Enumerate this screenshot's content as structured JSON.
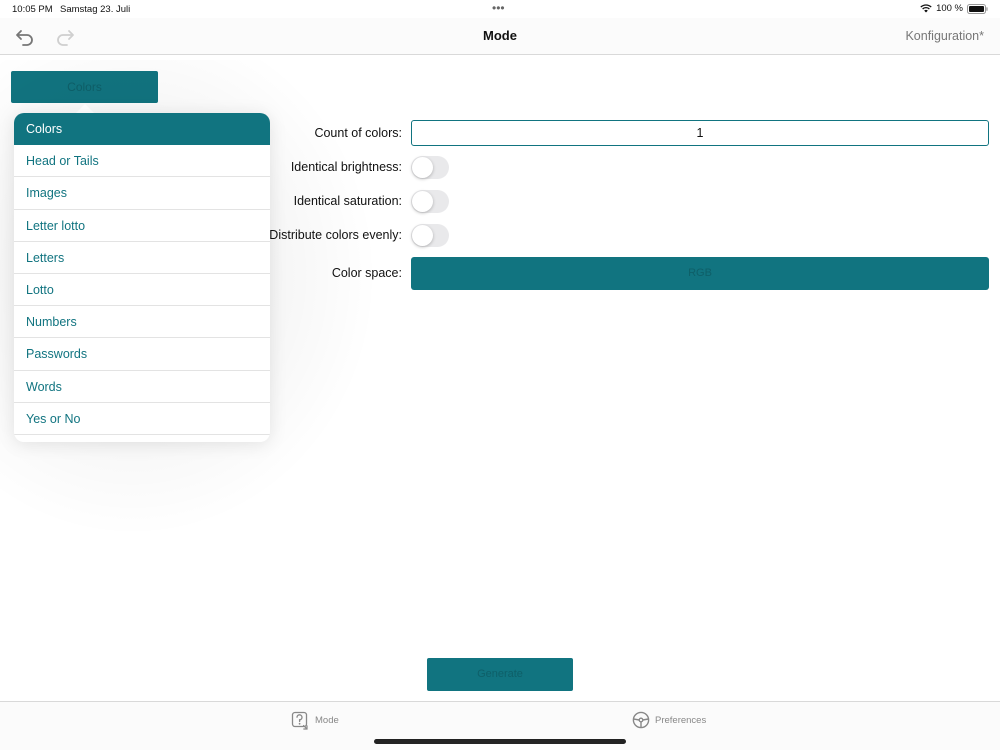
{
  "status_bar": {
    "time": "10:05 PM",
    "date": "Samstag 23. Juli",
    "dots": "•••",
    "battery_text": "100 %"
  },
  "nav": {
    "title": "Mode",
    "config_label": "Konfiguration*",
    "undo_icon": "undo-arrow-icon",
    "redo_icon": "redo-arrow-icon"
  },
  "mode_button": {
    "label": "Colors"
  },
  "menu": {
    "items": [
      {
        "label": "Colors",
        "selected": true
      },
      {
        "label": "Head or Tails"
      },
      {
        "label": "Images"
      },
      {
        "label": "Letter lotto"
      },
      {
        "label": "Letters"
      },
      {
        "label": "Lotto"
      },
      {
        "label": "Numbers"
      },
      {
        "label": "Passwords"
      },
      {
        "label": "Words"
      },
      {
        "label": "Yes or No"
      }
    ]
  },
  "form": {
    "count_label": "Count of colors:",
    "count_value": "1",
    "brightness_label": "Identical brightness:",
    "brightness_on": false,
    "saturation_label": "Identical saturation:",
    "saturation_on": false,
    "distribute_label": "Distribute colors evenly:",
    "distribute_on": false,
    "colorspace_label": "Color space:",
    "colorspace_value": "RGB"
  },
  "generate_button": {
    "label": "Generate"
  },
  "tab_bar": {
    "tabs": [
      {
        "label": "Mode",
        "icon": "dice-question-icon"
      },
      {
        "label": "Preferences",
        "icon": "steering-wheel-icon"
      }
    ]
  },
  "colors": {
    "accent": "#117480",
    "toggle_off": "#e9e9eb",
    "separator": "#d9d9d9"
  }
}
